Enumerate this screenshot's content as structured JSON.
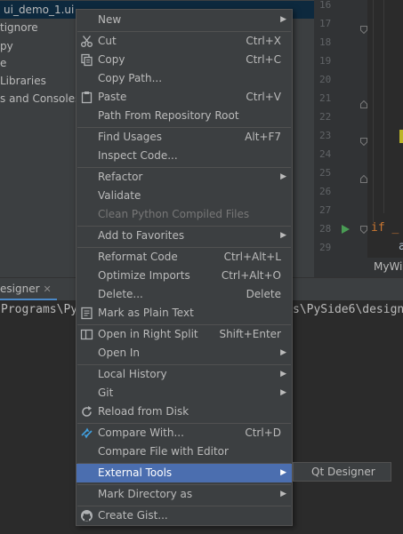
{
  "project_tree": {
    "items": [
      {
        "label": "ui_demo_1.ui",
        "selected": true
      },
      {
        "label": "tignore"
      },
      {
        "label": "py"
      },
      {
        "label": "e"
      },
      {
        "label": "Libraries"
      },
      {
        "label": "s and Consoles"
      }
    ]
  },
  "gutter": {
    "line_numbers": [
      "16",
      "17",
      "18",
      "19",
      "20",
      "21",
      "22",
      "23",
      "24",
      "25",
      "26",
      "27",
      "28",
      "29"
    ]
  },
  "editor": {
    "code_if": "if _",
    "code_a": "a",
    "breadcrumb": "MyWi"
  },
  "tool_window": {
    "tab_label": "esigner",
    "close_glyph": "✕",
    "console_left": "Programs\\Py",
    "console_right": "s\\PySide6\\design"
  },
  "context_menu": {
    "items": [
      {
        "label": "New",
        "shortcut": "",
        "submenu": true
      },
      {
        "label": "Cut",
        "shortcut": "Ctrl+X",
        "icon": "scissors-icon"
      },
      {
        "label": "Copy",
        "shortcut": "Ctrl+C",
        "icon": "copy-icon"
      },
      {
        "label": "Copy Path...",
        "shortcut": ""
      },
      {
        "label": "Paste",
        "shortcut": "Ctrl+V",
        "icon": "paste-icon"
      },
      {
        "label": "Path From Repository Root",
        "shortcut": ""
      },
      {
        "label": "Find Usages",
        "shortcut": "Alt+F7"
      },
      {
        "label": "Inspect Code...",
        "shortcut": ""
      },
      {
        "label": "Refactor",
        "shortcut": "",
        "submenu": true
      },
      {
        "label": "Validate",
        "shortcut": ""
      },
      {
        "label": "Clean Python Compiled Files",
        "shortcut": "",
        "disabled": true
      },
      {
        "label": "Add to Favorites",
        "shortcut": "",
        "submenu": true
      },
      {
        "label": "Reformat Code",
        "shortcut": "Ctrl+Alt+L"
      },
      {
        "label": "Optimize Imports",
        "shortcut": "Ctrl+Alt+O"
      },
      {
        "label": "Delete...",
        "shortcut": "Delete"
      },
      {
        "label": "Mark as Plain Text",
        "shortcut": "",
        "icon": "plain-text-icon"
      },
      {
        "label": "Open in Right Split",
        "shortcut": "Shift+Enter",
        "icon": "split-icon"
      },
      {
        "label": "Open In",
        "shortcut": "",
        "submenu": true
      },
      {
        "label": "Local History",
        "shortcut": "",
        "submenu": true
      },
      {
        "label": "Git",
        "shortcut": "",
        "submenu": true
      },
      {
        "label": "Reload from Disk",
        "shortcut": "",
        "icon": "reload-icon"
      },
      {
        "label": "Compare With...",
        "shortcut": "Ctrl+D",
        "icon": "compare-icon"
      },
      {
        "label": "Compare File with Editor",
        "shortcut": ""
      },
      {
        "label": "External Tools",
        "shortcut": "",
        "submenu": true,
        "active": true
      },
      {
        "label": "Mark Directory as",
        "shortcut": "",
        "submenu": true
      },
      {
        "label": "Create Gist...",
        "shortcut": "",
        "icon": "github-icon"
      }
    ],
    "submenu_arrow": "▶"
  },
  "submenu": {
    "items": [
      {
        "label": "Qt Designer"
      }
    ]
  },
  "colors": {
    "menu_bg": "#3c3f41",
    "selected_bg": "#4b6eaf",
    "text": "#bbbbbb"
  }
}
